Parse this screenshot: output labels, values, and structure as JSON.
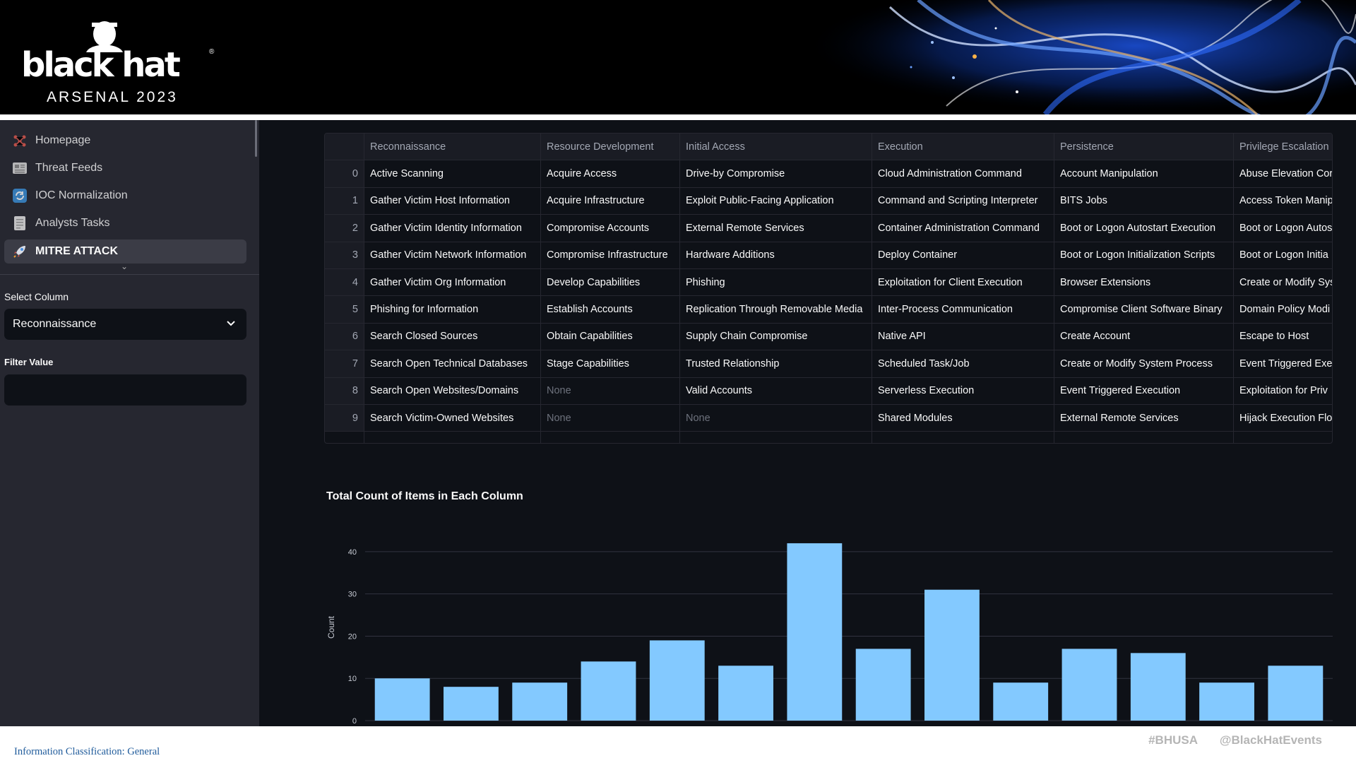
{
  "brand": {
    "logo_word": "black hat",
    "logo_sub": "ARSENAL 2023",
    "logo_reg": "®"
  },
  "sidebar": {
    "items": [
      {
        "label": "Homepage",
        "icon": "network-icon"
      },
      {
        "label": "Threat Feeds",
        "icon": "newspaper-icon"
      },
      {
        "label": "IOC Normalization",
        "icon": "refresh-icon"
      },
      {
        "label": "Analysts Tasks",
        "icon": "document-icon"
      },
      {
        "label": "MITRE ATTACK",
        "icon": "rocket-icon",
        "active": true
      }
    ],
    "select_label": "Select Column",
    "select_value": "Reconnaissance",
    "filter_label": "Filter Value",
    "filter_value": ""
  },
  "table": {
    "columns": [
      "",
      "Reconnaissance",
      "Resource Development",
      "Initial Access",
      "Execution",
      "Persistence",
      "Privilege Escalation"
    ],
    "rows": [
      [
        "0",
        "Active Scanning",
        "Acquire Access",
        "Drive-by Compromise",
        "Cloud Administration Command",
        "Account Manipulation",
        "Abuse Elevation Cor"
      ],
      [
        "1",
        "Gather Victim Host Information",
        "Acquire Infrastructure",
        "Exploit Public-Facing Application",
        "Command and Scripting Interpreter",
        "BITS Jobs",
        "Access Token Manip"
      ],
      [
        "2",
        "Gather Victim Identity Information",
        "Compromise Accounts",
        "External Remote Services",
        "Container Administration Command",
        "Boot or Logon Autostart Execution",
        "Boot or Logon Autos"
      ],
      [
        "3",
        "Gather Victim Network Information",
        "Compromise Infrastructure",
        "Hardware Additions",
        "Deploy Container",
        "Boot or Logon Initialization Scripts",
        "Boot or Logon Initia"
      ],
      [
        "4",
        "Gather Victim Org Information",
        "Develop Capabilities",
        "Phishing",
        "Exploitation for Client Execution",
        "Browser Extensions",
        "Create or Modify Sys"
      ],
      [
        "5",
        "Phishing for Information",
        "Establish Accounts",
        "Replication Through Removable Media",
        "Inter-Process Communication",
        "Compromise Client Software Binary",
        "Domain Policy Modi"
      ],
      [
        "6",
        "Search Closed Sources",
        "Obtain Capabilities",
        "Supply Chain Compromise",
        "Native API",
        "Create Account",
        "Escape to Host"
      ],
      [
        "7",
        "Search Open Technical Databases",
        "Stage Capabilities",
        "Trusted Relationship",
        "Scheduled Task/Job",
        "Create or Modify System Process",
        "Event Triggered Exe"
      ],
      [
        "8",
        "Search Open Websites/Domains",
        "None",
        "Valid Accounts",
        "Serverless Execution",
        "Event Triggered Execution",
        "Exploitation for Priv"
      ],
      [
        "9",
        "Search Victim-Owned Websites",
        "None",
        "None",
        "Shared Modules",
        "External Remote Services",
        "Hijack Execution Flo"
      ]
    ]
  },
  "chart_title": "Total Count of Items in Each Column",
  "chart_data": {
    "type": "bar",
    "title": "Total Count of Items in Each Column",
    "xlabel": "",
    "ylabel": "Count",
    "ylim": [
      0,
      44
    ],
    "yticks": [
      0,
      10,
      20,
      30,
      40
    ],
    "grid": true,
    "values": [
      10,
      8,
      9,
      14,
      19,
      13,
      42,
      17,
      31,
      9,
      17,
      16,
      9,
      13
    ],
    "color": "#83c9ff"
  },
  "footer": {
    "classification": "Information Classification: General",
    "hashtag": "#BHUSA",
    "handle": "@BlackHatEvents"
  },
  "colors": {
    "app_bg": "#0e1117",
    "sidebar_bg": "#262730",
    "bar": "#83c9ff",
    "text": "#fafafa"
  }
}
